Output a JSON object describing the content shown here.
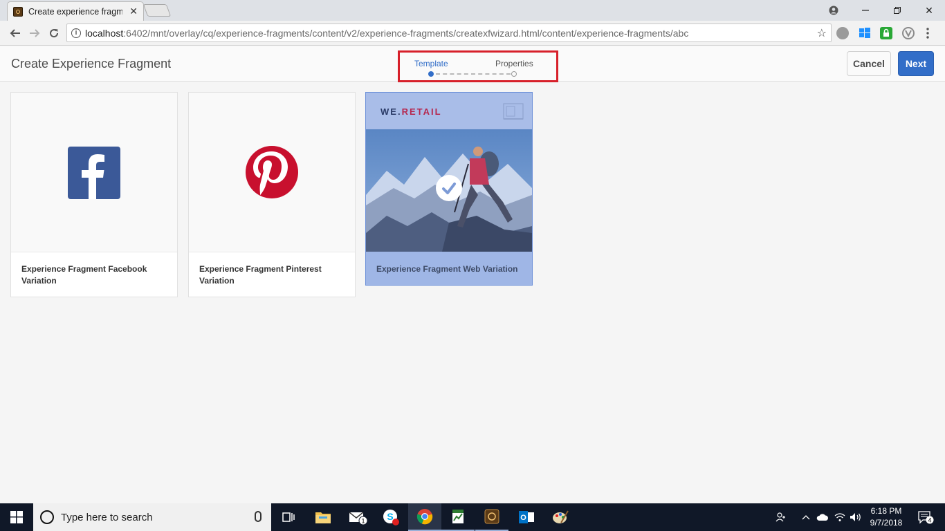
{
  "browser": {
    "tab_title": "Create experience fragme",
    "url_host": "localhost",
    "url_path": ":6402/mnt/overlay/cq/experience-fragments/content/v2/experience-fragments/createxfwizard.html/content/experience-fragments/abc"
  },
  "header": {
    "title": "Create Experience Fragment",
    "steps": [
      {
        "label": "Template",
        "active": true
      },
      {
        "label": "Properties",
        "active": false
      }
    ],
    "cancel_label": "Cancel",
    "next_label": "Next"
  },
  "templates": [
    {
      "label": "Experience Fragment Facebook Variation",
      "icon": "facebook-icon",
      "selected": false
    },
    {
      "label": "Experience Fragment Pinterest Variation",
      "icon": "pinterest-icon",
      "selected": false
    },
    {
      "label": "Experience Fragment Web Variation",
      "brand_we": "WE.",
      "brand_retail": "RETAIL",
      "selected": true
    }
  ],
  "taskbar": {
    "search_placeholder": "Type here to search",
    "time": "6:18 PM",
    "date": "9/7/2018",
    "mail_badge": "1",
    "notification_badge": "4"
  },
  "colors": {
    "primary": "#326ec8",
    "highlight_box": "#d7202a",
    "facebook": "#3b5998",
    "pinterest": "#c8102e",
    "selected_card": "#9fb6e6"
  }
}
